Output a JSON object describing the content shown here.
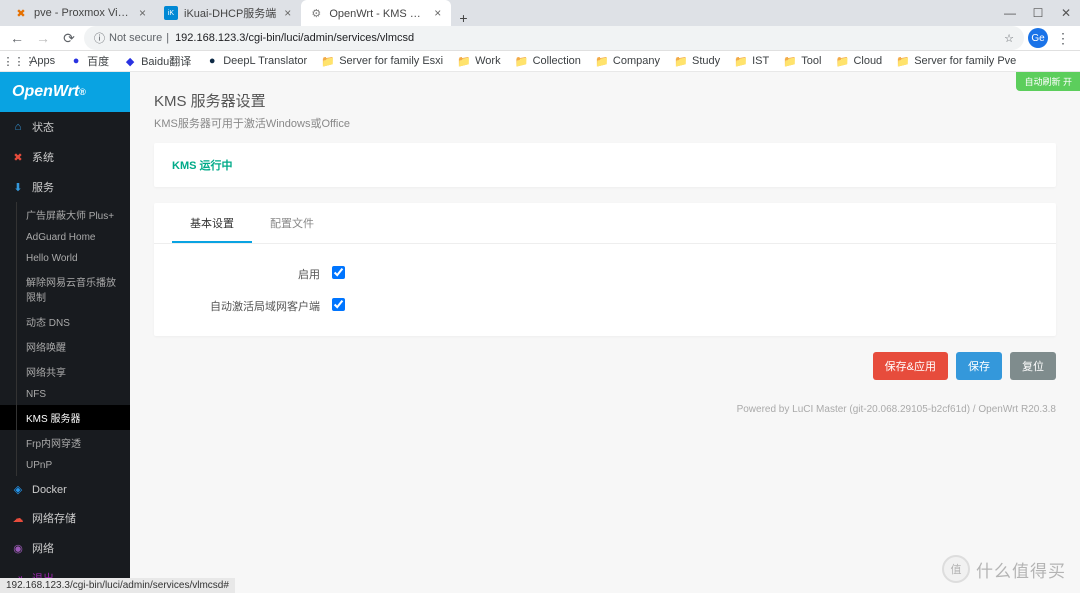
{
  "browser": {
    "tabs": [
      {
        "title": "pve - Proxmox Virtual Environme",
        "favicon": "✖",
        "faviconColor": "#e57000"
      },
      {
        "title": "iKuai-DHCP服务端",
        "favicon": "iK",
        "faviconColor": "#0088d4"
      },
      {
        "title": "OpenWrt - KMS 服务器 - LuCI",
        "favicon": "⚙",
        "faviconColor": "#7c7c7c"
      }
    ],
    "url": {
      "secure_label": "Not secure",
      "address": "192.168.123.3/cgi-bin/luci/admin/services/vlmcsd"
    },
    "avatar": "Ge",
    "bookmarks_label": "Apps",
    "bookmarks": [
      {
        "label": "百度",
        "icon": "●",
        "color": "#2932e1"
      },
      {
        "label": "Baidu翻译",
        "icon": "◆",
        "color": "#2932e1"
      },
      {
        "label": "DeepL Translator",
        "icon": "●",
        "color": "#0f2b46"
      },
      {
        "label": "Server for family Esxi",
        "icon": "📁"
      },
      {
        "label": "Work",
        "icon": "📁"
      },
      {
        "label": "Collection",
        "icon": "📁"
      },
      {
        "label": "Company",
        "icon": "📁"
      },
      {
        "label": "Study",
        "icon": "📁"
      },
      {
        "label": "IST",
        "icon": "📁"
      },
      {
        "label": "Tool",
        "icon": "📁"
      },
      {
        "label": "Cloud",
        "icon": "📁"
      },
      {
        "label": "Server for family Pve",
        "icon": "📁"
      }
    ],
    "status_bar": "192.168.123.3/cgi-bin/luci/admin/services/vlmcsd#"
  },
  "app": {
    "logo": "OpenWrt",
    "auto_refresh": "自动刷新 开",
    "nav": {
      "status": "状态",
      "system": "系统",
      "services": "服务",
      "services_items": [
        "广告屏蔽大师 Plus+",
        "AdGuard Home",
        "Hello World",
        "解除网易云音乐播放限制",
        "动态 DNS",
        "网络唤醒",
        "网络共享",
        "NFS",
        "KMS 服务器",
        "Frp内网穿透",
        "UPnP"
      ],
      "docker": "Docker",
      "nas": "网络存储",
      "network": "网络",
      "logout": "退出"
    },
    "page": {
      "title": "KMS 服务器设置",
      "desc": "KMS服务器可用于激活Windows或Office",
      "status": "KMS 运行中",
      "tabs": {
        "basic": "基本设置",
        "config": "配置文件"
      },
      "fields": {
        "enable": "启用",
        "auto_activate": "自动激活局域网客户端"
      },
      "buttons": {
        "save_apply": "保存&应用",
        "save": "保存",
        "reset": "复位"
      },
      "footer": "Powered by LuCI Master (git-20.068.29105-b2cf61d) / OpenWrt R20.3.8"
    }
  },
  "watermark": {
    "badge": "值",
    "text": "什么值得买"
  }
}
